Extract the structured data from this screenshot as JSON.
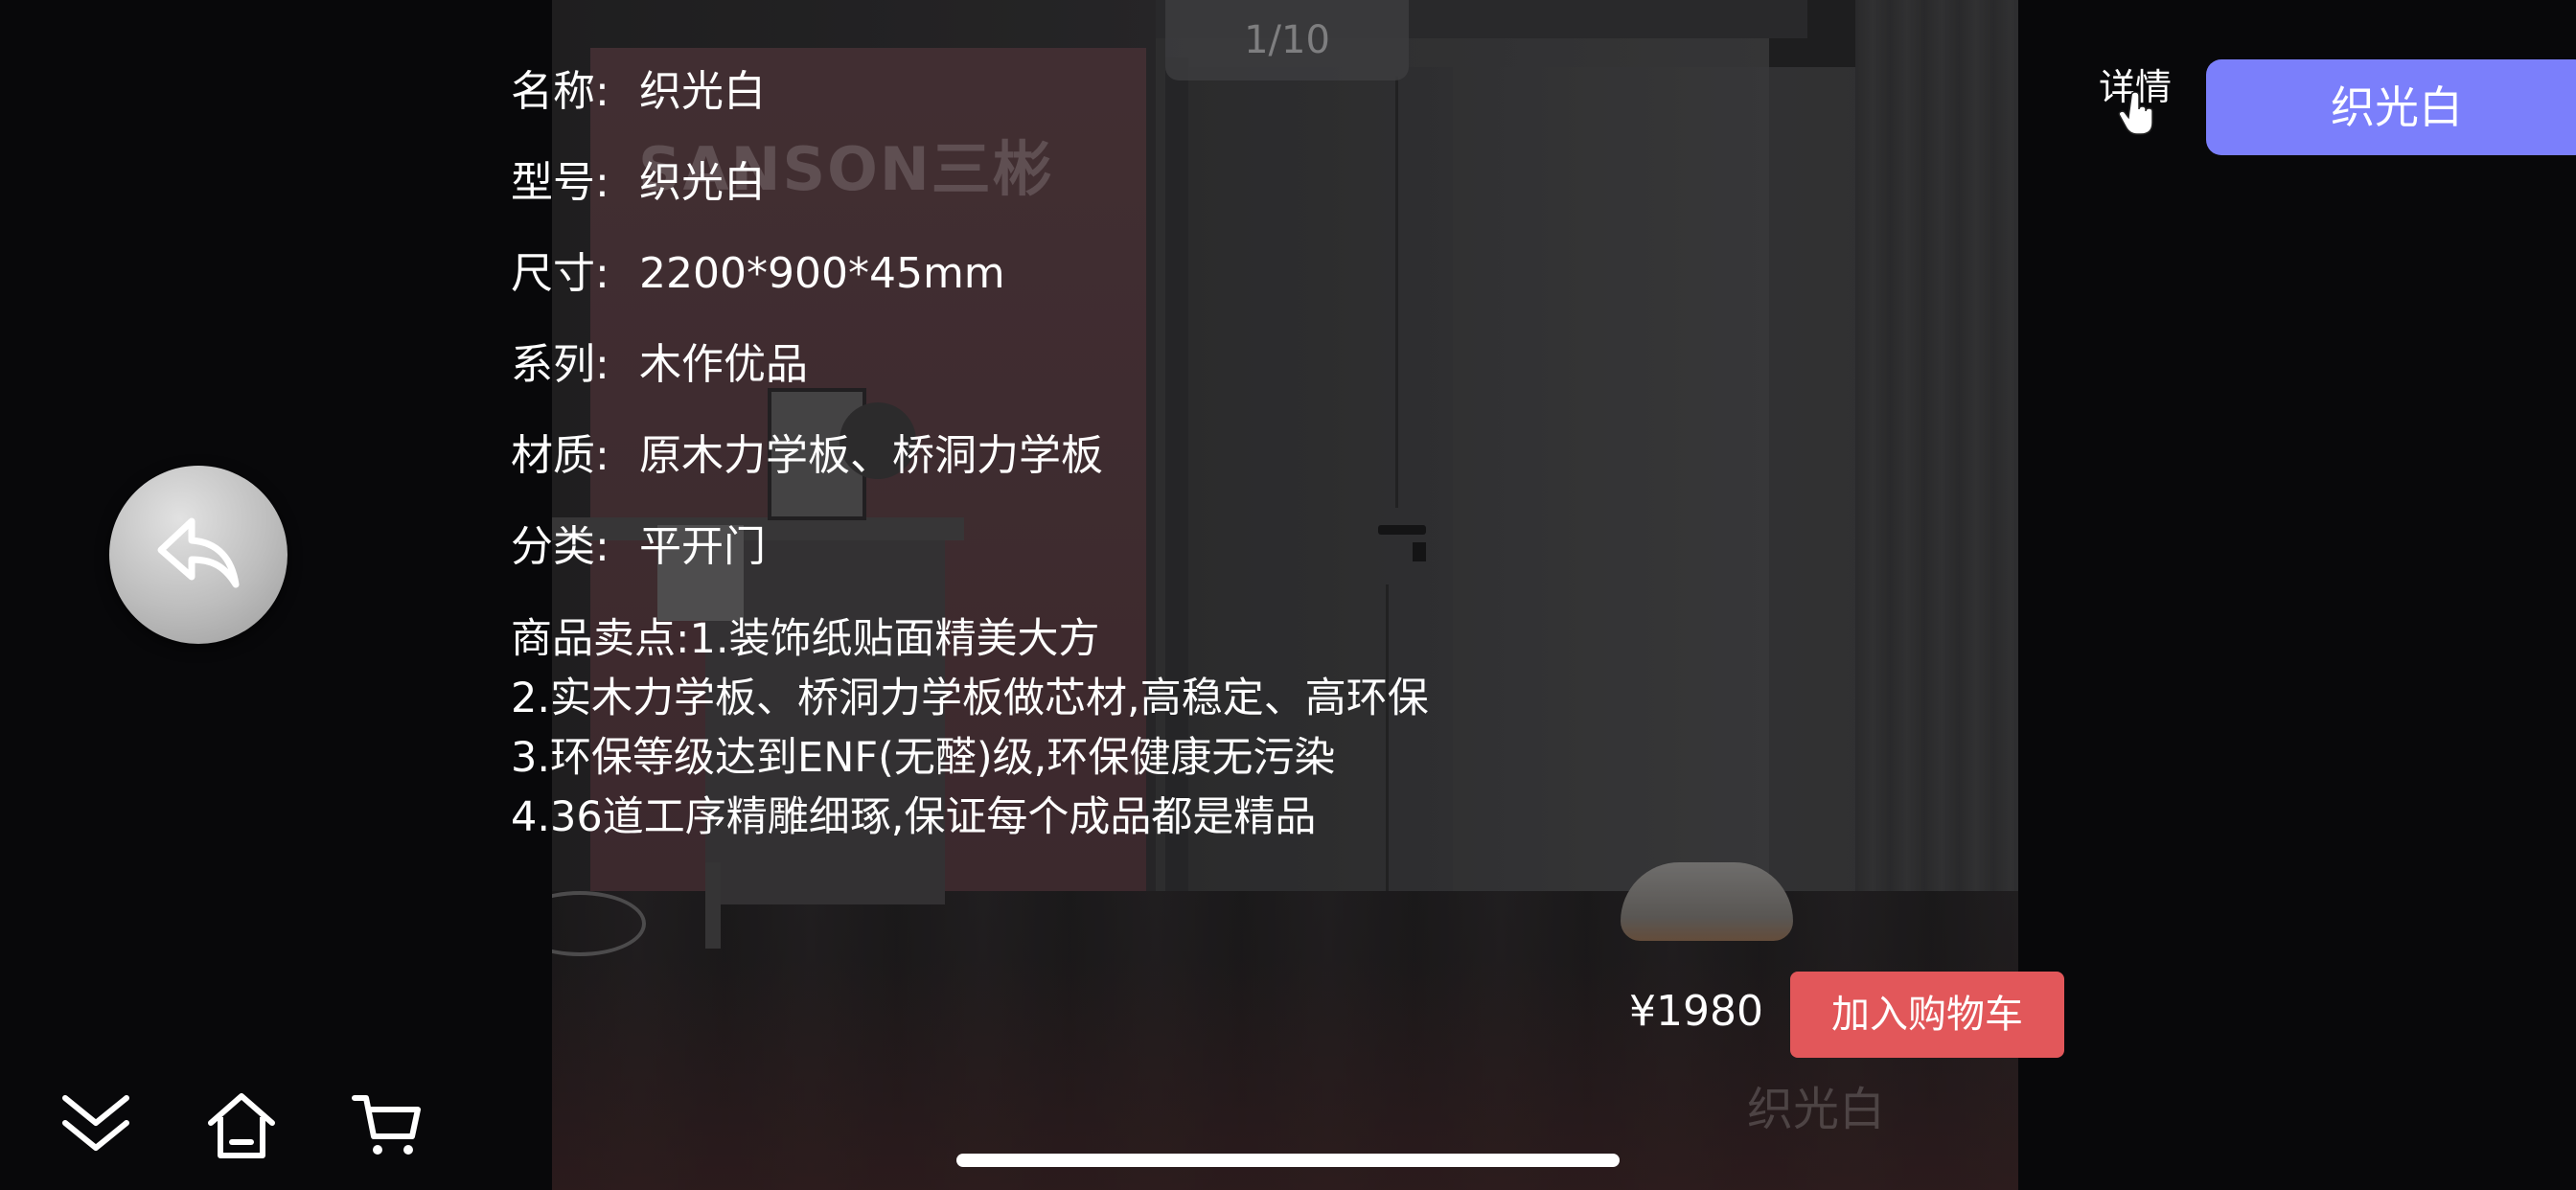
{
  "pager": {
    "text": "1/10"
  },
  "scene": {
    "watermark": "SANSON三彬",
    "caption": "织光白"
  },
  "product": {
    "name_label": "名称:",
    "name_value": "织光白",
    "model_label": "型号:",
    "model_value": "织光白",
    "size_label": "尺寸:",
    "size_value": "2200*900*45mm",
    "series_label": "系列:",
    "series_value": "木作优品",
    "material_label": "材质:",
    "material_value": "原木力学板、桥洞力学板",
    "category_label": "分类:",
    "category_value": "平开门",
    "selling_points": [
      "商品卖点:1.装饰纸贴面精美大方",
      "2.实木力学板、桥洞力学板做芯材,高稳定、高环保",
      "3.环保等级达到ENF(无醛)级,环保健康无污染",
      "4.36道工序精雕细琢,保证每个成品都是精品"
    ]
  },
  "toolbar": {
    "details_label": "详情",
    "variant_label": "织光白"
  },
  "purchase": {
    "price": "¥1980",
    "add_to_cart_label": "加入购物车"
  },
  "icons": {
    "back": "back-arrow-icon",
    "collapse": "double-chevron-down-icon",
    "home": "home-icon",
    "cart": "shopping-cart-icon",
    "pointer": "hand-pointer-icon"
  },
  "colors": {
    "variant_button": "#7b7ffb",
    "add_to_cart_button": "#e2575a",
    "background": "#08080a"
  }
}
